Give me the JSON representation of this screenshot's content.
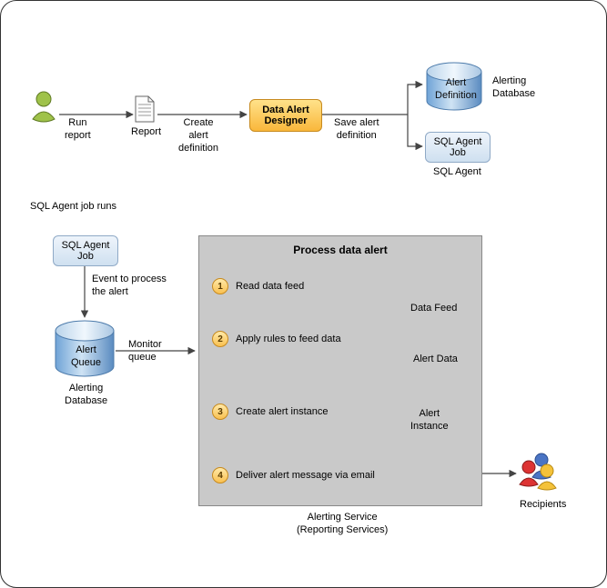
{
  "top": {
    "run_report": "Run\nreport",
    "report": "Report",
    "create_alert_def": "Create\nalert\ndefinition",
    "data_alert_designer": "Data Alert\nDesigner",
    "save_alert_def": "Save alert\ndefinition",
    "alert_definition": "Alert\nDefinition",
    "alerting_db": "Alerting\nDatabase",
    "sql_agent_job": "SQL\nAgent Job",
    "sql_agent": "SQL Agent"
  },
  "section_label": "SQL Agent job runs",
  "left": {
    "sql_agent_job": "SQL\nAgent Job",
    "event_to_process": "Event to process\nthe alert",
    "alert_queue": "Alert\nQueue",
    "alerting_db": "Alerting\nDatabase",
    "monitor_queue": "Monitor\nqueue"
  },
  "panel": {
    "title": "Process data alert",
    "steps": [
      {
        "n": "1",
        "text": "Read data feed"
      },
      {
        "n": "2",
        "text": "Apply rules to feed data"
      },
      {
        "n": "3",
        "text": "Create alert instance"
      },
      {
        "n": "4",
        "text": "Deliver alert message via email"
      }
    ],
    "data_feed": "Data Feed",
    "alert_data": "Alert Data",
    "alert_instance": "Alert\nInstance",
    "caption": "Alerting Service\n(Reporting Services)"
  },
  "recipients": "Recipients"
}
